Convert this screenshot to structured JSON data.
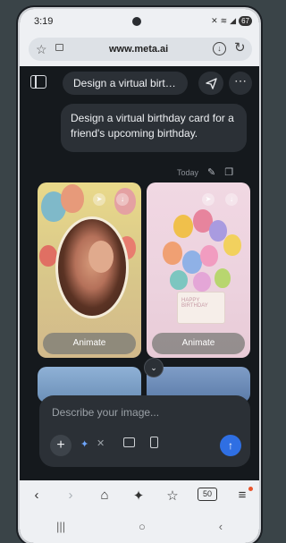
{
  "status": {
    "time": "3:19",
    "battery": "67"
  },
  "browser": {
    "url": "www.meta.ai"
  },
  "chat": {
    "title": "Design a virtual birt…",
    "user_message": "Design a virtual birthday card for a friend's upcoming birthday.",
    "timestamp": "Today"
  },
  "cards": [
    {
      "button_label": "Animate",
      "envelope_text": ""
    },
    {
      "button_label": "Animate",
      "envelope_text": "HAPPY BIRTHDAY"
    }
  ],
  "composer": {
    "placeholder": "Describe your image..."
  },
  "colors": {
    "send_button": "#2f6fe3",
    "accent_sparkle": "#6ea6ff",
    "notification_dot": "#e8542c"
  },
  "icons": {
    "browser_nav": [
      "back-icon",
      "forward-icon",
      "home-icon",
      "sparkle-icon",
      "bookmark-star-icon",
      "tabs-icon",
      "menu-icon"
    ],
    "tabs_count": "50"
  }
}
